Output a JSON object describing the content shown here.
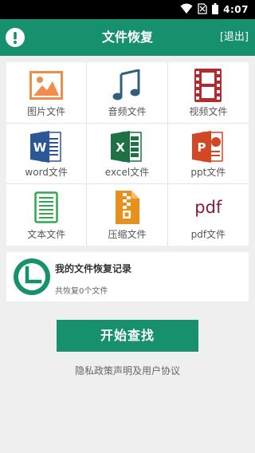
{
  "status_bar": {
    "time": "4:07",
    "icons": [
      "wifi-icon",
      "no-sim-icon",
      "battery-icon"
    ]
  },
  "app_bar": {
    "title": "文件恢复",
    "exit_label": "[退出]",
    "alert_icon": "alert-icon"
  },
  "file_types": [
    {
      "label": "图片文件",
      "icon": "image-icon"
    },
    {
      "label": "音频文件",
      "icon": "music-icon"
    },
    {
      "label": "视频文件",
      "icon": "film-icon"
    },
    {
      "label": "word文件",
      "icon": "word-icon",
      "icon_letter": "W"
    },
    {
      "label": "excel文件",
      "icon": "excel-icon",
      "icon_letter": "X"
    },
    {
      "label": "ppt文件",
      "icon": "ppt-icon",
      "icon_letter": "P"
    },
    {
      "label": "文本文件",
      "icon": "text-file-icon"
    },
    {
      "label": "压缩文件",
      "icon": "zip-icon"
    },
    {
      "label": "pdf文件",
      "icon": "pdf-icon",
      "icon_text": "pdf"
    }
  ],
  "history": {
    "title": "我的文件恢复记录",
    "count_text": "共恢复0个文件",
    "icon": "clock-icon"
  },
  "start_button": {
    "label": "开始查找"
  },
  "privacy_link": {
    "label": "隐私政策声明及用户协议"
  },
  "colors": {
    "primary": "#16906d",
    "background": "#efefef",
    "status_bar": "#000000",
    "image_icon": "#f08c4c",
    "music_icon": "#2f5f7f",
    "video_icon": "#b3292e",
    "word_icon": "#2b5797",
    "excel_icon": "#1e7145",
    "ppt_icon": "#d24726",
    "text_icon": "#2fa84f",
    "zip_icon": "#e8901c",
    "pdf_icon": "#8b1b3c"
  }
}
